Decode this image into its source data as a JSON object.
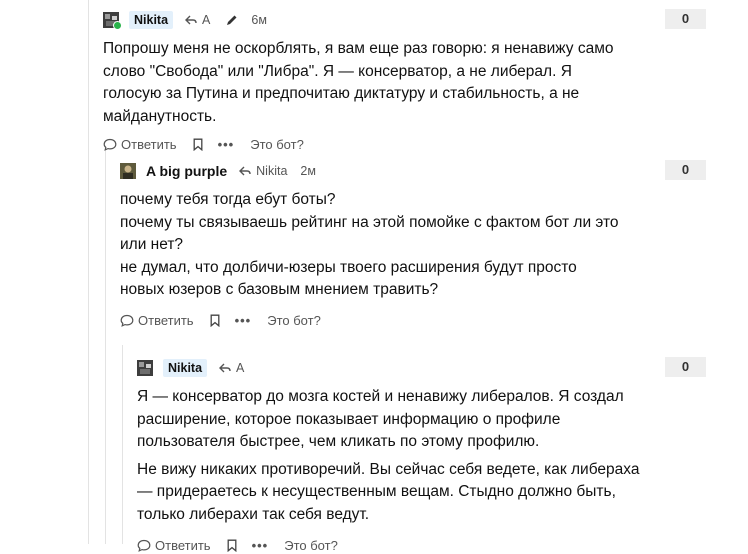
{
  "comments": [
    {
      "author": "Nikita",
      "reply_to": "A",
      "time": "6м",
      "rating": "0",
      "paragraphs": [
        "Попрошу меня не оскорблять, я вам еще раз говорю: я ненавижу само слово \"Свобода\" или \"Либра\". Я — консерватор, а не либерал. Я голосую за Путина и предпочитаю диктатуру и стабильность, а не майданутность."
      ],
      "actions": {
        "reply": "Ответить",
        "more": "•••",
        "bot": "Это бот?"
      }
    },
    {
      "author": "A big purple",
      "reply_to": "Nikita",
      "time": "2м",
      "rating": "0",
      "paragraphs": [
        "почему тебя тогда ебут боты?\nпочему ты связываешь рейтинг на этой помойке с фактом бот ли это или нет?\nне думал, что долбичи-юзеры твоего расширения будут просто новых юзеров с базовым мнением травить?"
      ],
      "actions": {
        "reply": "Ответить",
        "more": "•••",
        "bot": "Это бот?"
      }
    },
    {
      "author": "Nikita",
      "reply_to": "A",
      "rating": "0",
      "paragraphs": [
        "Я — консерватор до мозга костей и ненавижу либералов. Я создал расширение, которое показывает информацию о профиле пользователя быстрее, чем кликать по этому профилю.",
        "Не вижу никаких противоречий. Вы сейчас себя ведете, как либераха — придераетесь к несущественным вещам. Стыдно должно быть, только либерахи так себя ведут."
      ],
      "actions": {
        "reply": "Ответить",
        "more": "•••",
        "bot": "Это бот?"
      }
    }
  ]
}
